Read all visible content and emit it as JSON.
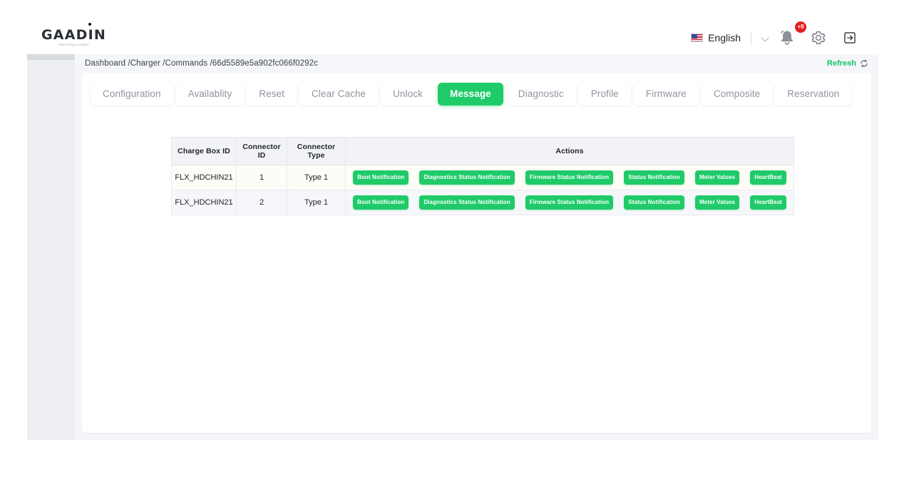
{
  "header": {
    "logo_text": "GAADIN",
    "logo_tagline": "Green Energy Company",
    "language": "English",
    "language_icon": "us-flag-icon",
    "language_chevron_icon": "chevron-down-icon",
    "notification_icon": "bell-icon",
    "notification_badge": "+9",
    "settings_icon": "gear-icon",
    "logout_icon": "logout-icon"
  },
  "breadcrumb": {
    "text": "Dashboard /Charger /Commands /66d5589e5a902fc066f0292c"
  },
  "refresh": {
    "label": "Refresh",
    "icon": "refresh-icon"
  },
  "tabs": [
    {
      "label": "Configuration",
      "active": false
    },
    {
      "label": "Availablity",
      "active": false
    },
    {
      "label": "Reset",
      "active": false
    },
    {
      "label": "Clear Cache",
      "active": false
    },
    {
      "label": "Unlock",
      "active": false
    },
    {
      "label": "Message",
      "active": true
    },
    {
      "label": "Diagnostic",
      "active": false
    },
    {
      "label": "Profile",
      "active": false
    },
    {
      "label": "Firmware",
      "active": false
    },
    {
      "label": "Composite",
      "active": false
    },
    {
      "label": "Reservation",
      "active": false
    }
  ],
  "table": {
    "headers": {
      "charge_box_id": "Charge Box ID",
      "connector_id": "Connector ID",
      "connector_type": "Connector Type",
      "actions": "Actions"
    },
    "rows": [
      {
        "charge_box_id": "FLX_HDCHIN21",
        "connector_id": "1",
        "connector_type": "Type 1",
        "actions": [
          "Boot Notification",
          "Diagnostics Status Notification",
          "Firmware Status Notification",
          "Status Notification",
          "Meter Values",
          "HeartBeat"
        ]
      },
      {
        "charge_box_id": "FLX_HDCHIN21",
        "connector_id": "2",
        "connector_type": "Type 1",
        "actions": [
          "Boot Notification",
          "Diagnostics Status Notification",
          "Firmware Status Notification",
          "Status Notification",
          "Meter Values",
          "HeartBeat"
        ]
      }
    ]
  },
  "colors": {
    "accent_green": "#1fcb68",
    "badge_red": "#e52020",
    "page_bg": "#f5f6f9",
    "rail_bg": "#eceef1"
  }
}
